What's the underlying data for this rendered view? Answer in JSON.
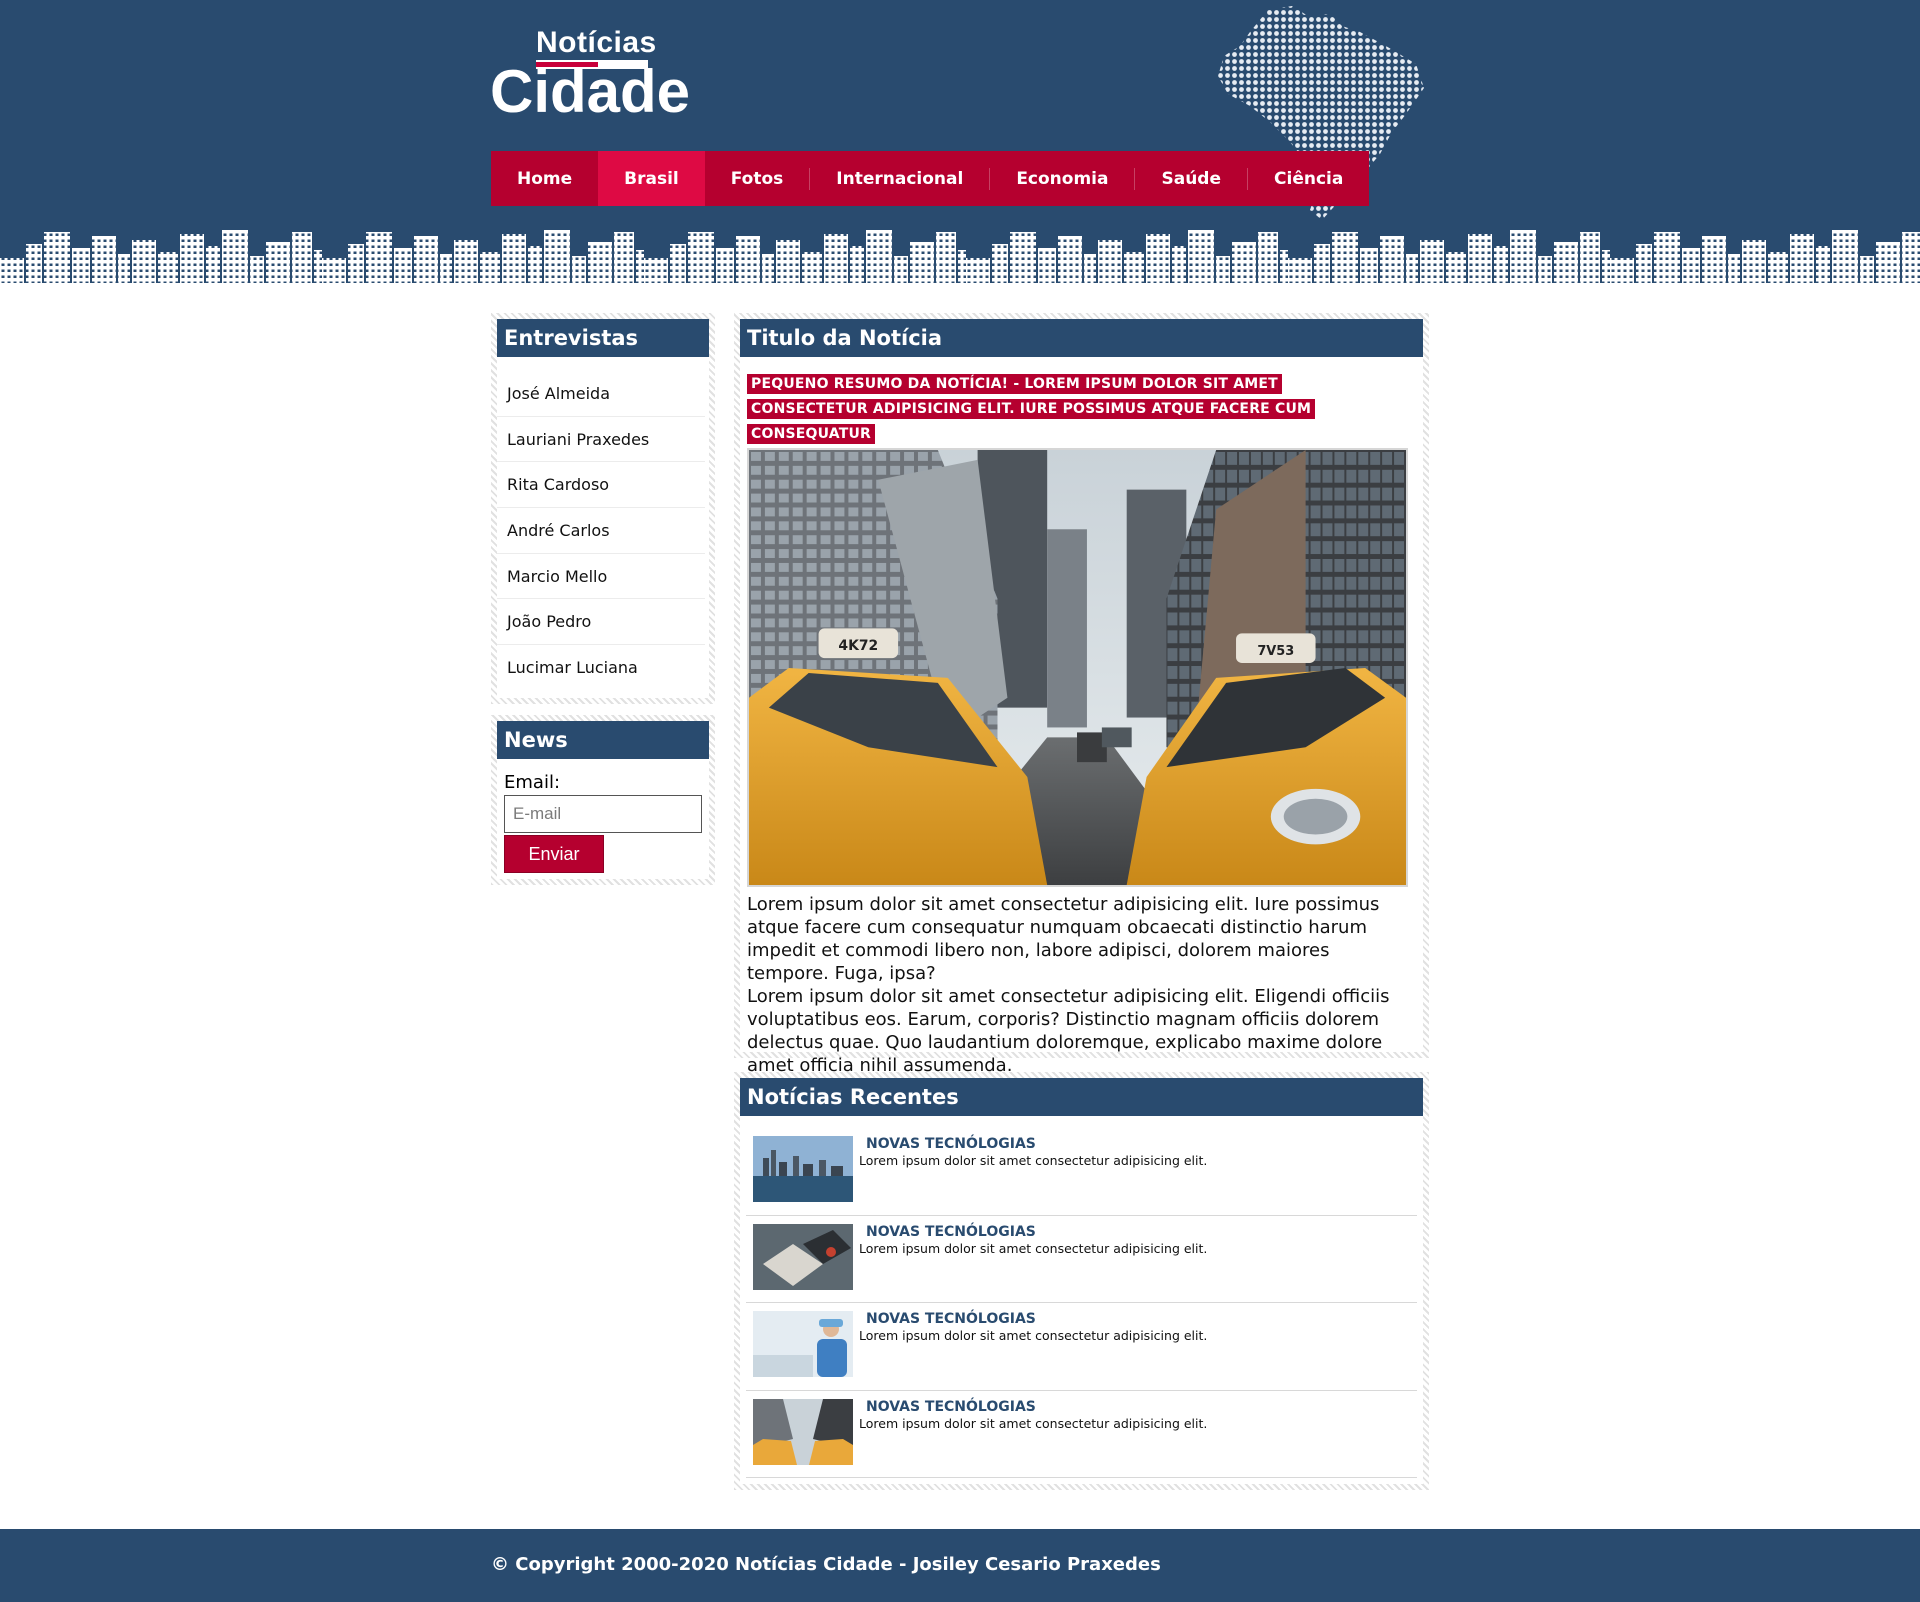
{
  "brand": {
    "logo_top": "Notícias",
    "logo_main": "Cidade"
  },
  "nav": [
    {
      "label": "Home",
      "active": false
    },
    {
      "label": "Brasil",
      "active": true
    },
    {
      "label": "Fotos",
      "active": false
    },
    {
      "label": "Internacional",
      "active": false
    },
    {
      "label": "Economia",
      "active": false
    },
    {
      "label": "Saúde",
      "active": false
    },
    {
      "label": "Ciência",
      "active": false
    }
  ],
  "sidebar": {
    "interviews_title": "Entrevistas",
    "interviews": [
      "José Almeida",
      "Lauriani Praxedes",
      "Rita Cardoso",
      "André Carlos",
      "Marcio Mello",
      "João Pedro",
      "Lucimar Luciana"
    ],
    "news_title": "News",
    "email_label": "Email:",
    "email_placeholder": "E-mail",
    "submit_label": "Enviar"
  },
  "article": {
    "title": "Titulo da Notícia",
    "summary": "PEQUENO RESUMO DA NOTÍCIA! - LOREM IPSUM DOLOR SIT AMET CONSECTETUR ADIPISICING ELIT. IURE POSSIMUS ATQUE FACERE CUM CONSEQUATUR",
    "paragraph_1": "Lorem ipsum dolor sit amet consectetur adipisicing elit. Iure possimus atque facere cum consequatur numquam obcaecati distinctio harum impedit et commodi libero non, labore adipisci, dolorem maiores tempore. Fuga, ipsa?",
    "paragraph_2": "Lorem ipsum dolor sit amet consectetur adipisicing elit. Eligendi officiis voluptatibus eos. Earum, corporis? Distinctio magnam officiis dolorem delectus quae. Quo laudantium doloremque, explicabo maxime dolore amet officia nihil assumenda.",
    "taxi_left_plate": "4K72",
    "taxi_right_plate": "7V53"
  },
  "recent": {
    "title": "Notícias Recentes",
    "items": [
      {
        "title": "NOVAS TECNÓLOGIAS",
        "desc": "Lorem ipsum dolor sit amet consectetur adipisicing elit.",
        "thumb": "city-skyline"
      },
      {
        "title": "NOVAS TECNÓLOGIAS",
        "desc": "Lorem ipsum dolor sit amet consectetur adipisicing elit.",
        "thumb": "desk-notebook"
      },
      {
        "title": "NOVAS TECNÓLOGIAS",
        "desc": "Lorem ipsum dolor sit amet consectetur adipisicing elit.",
        "thumb": "doctor"
      },
      {
        "title": "NOVAS TECNÓLOGIAS",
        "desc": "Lorem ipsum dolor sit amet consectetur adipisicing elit.",
        "thumb": "taxis"
      }
    ]
  },
  "footer": {
    "text": "© Copyright 2000-2020 Notícias Cidade - Josiley Cesario Praxedes"
  },
  "colors": {
    "navy": "#294b6f",
    "crimson": "#b5002f",
    "crimson_active": "#de0a44"
  }
}
